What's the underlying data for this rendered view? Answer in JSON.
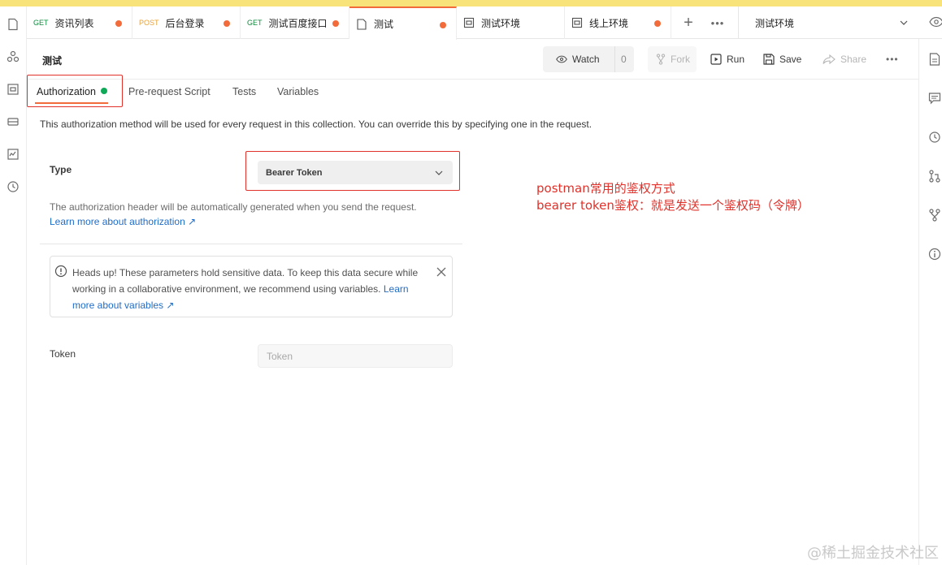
{
  "tabs": [
    {
      "method": "GET",
      "label": "资讯列表",
      "dirty": true
    },
    {
      "method": "POST",
      "label": "后台登录",
      "dirty": true
    },
    {
      "method": "GET",
      "label": "测试百度接口",
      "dirty": true
    },
    {
      "method": "",
      "label": "测试",
      "dirty": true,
      "active": true,
      "icon": "collection-icon"
    },
    {
      "method": "",
      "label": "测试环境",
      "dirty": false,
      "icon": "environment-icon"
    },
    {
      "method": "",
      "label": "线上环境",
      "dirty": true,
      "icon": "environment-icon"
    }
  ],
  "environment": {
    "selected": "测试环境"
  },
  "header": {
    "title": "测试",
    "watch_label": "Watch",
    "watch_count": "0",
    "fork_label": "Fork",
    "run_label": "Run",
    "save_label": "Save",
    "share_label": "Share"
  },
  "subtabs": {
    "authorization": "Authorization",
    "prerequest": "Pre-request Script",
    "tests": "Tests",
    "variables": "Variables"
  },
  "auth": {
    "description": "This authorization method will be used for every request in this collection. You can override this by specifying one in the request.",
    "type_label": "Type",
    "type_value": "Bearer Token",
    "help_text": "The authorization header will be automatically generated when you send the request.",
    "learn_more": "Learn more about authorization ↗",
    "alert_text": "Heads up! These parameters hold sensitive data. To keep this data secure while working in a collaborative environment, we recommend using variables.",
    "alert_link": "Learn more about variables ↗",
    "token_label": "Token",
    "token_placeholder": "Token"
  },
  "annotations": {
    "line1": "postman常用的鉴权方式",
    "line2": "bearer token鉴权：就是发送一个鉴权码（令牌）"
  },
  "watermark": "@稀土掘金技术社区",
  "colors": {
    "accent": "#f26b3a",
    "annotation": "#e0312a",
    "link": "#1f6cc7",
    "status_ok": "#0fa958"
  }
}
